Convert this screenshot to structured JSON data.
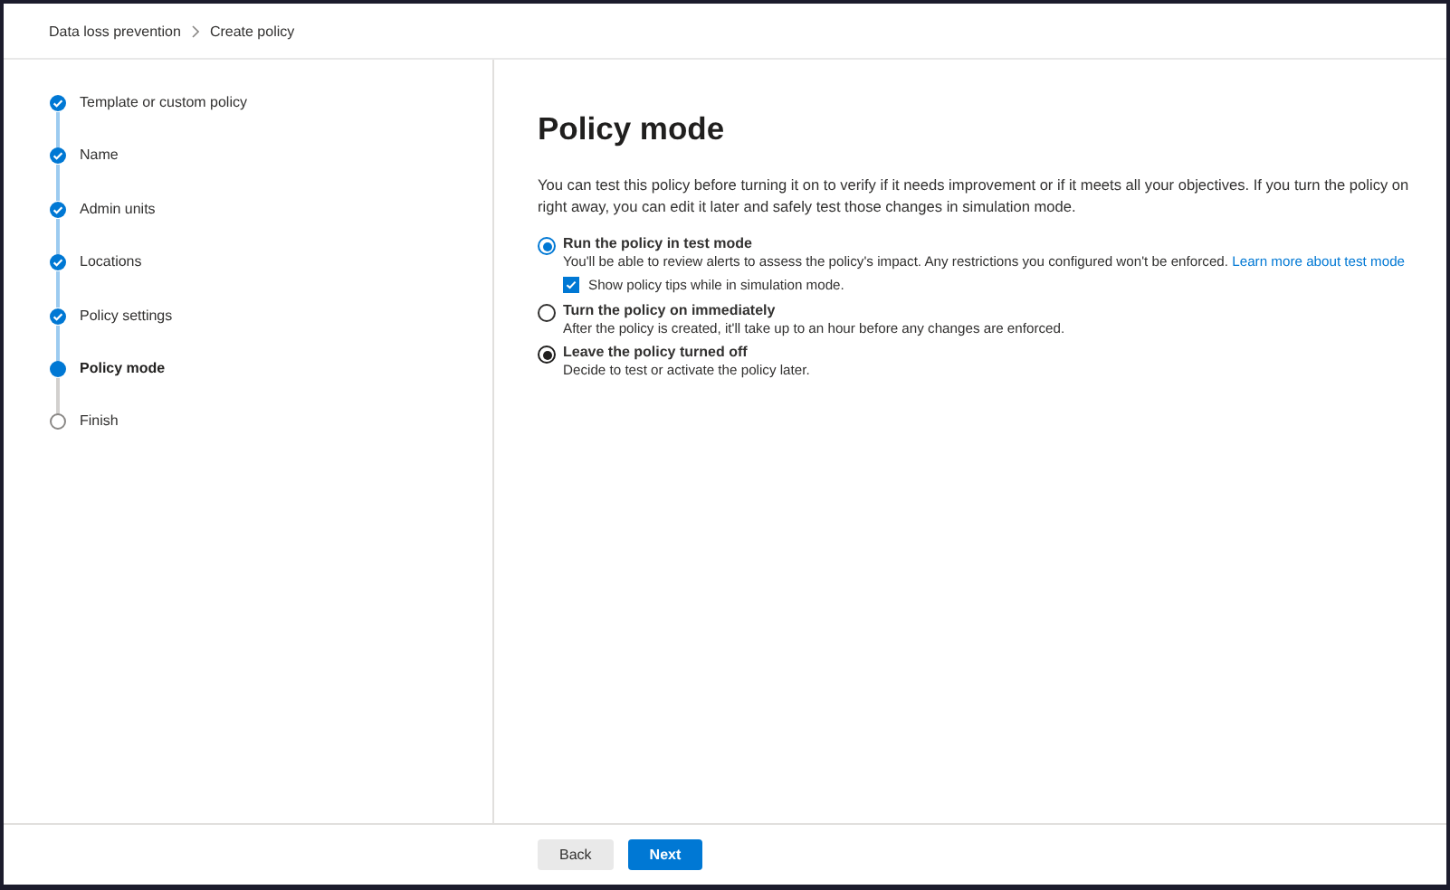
{
  "breadcrumb": [
    "Data loss prevention",
    "Create policy"
  ],
  "steps": [
    {
      "label": "Template or custom policy",
      "completed": true,
      "selected": false
    },
    {
      "label": "Name",
      "completed": true,
      "selected": false
    },
    {
      "label": "Admin units",
      "completed": true,
      "selected": false
    },
    {
      "label": "Locations",
      "completed": true,
      "selected": false
    },
    {
      "label": "Policy settings",
      "completed": true,
      "selected": false
    },
    {
      "label": "Policy mode",
      "completed": false,
      "selected": true
    },
    {
      "label": "Finish",
      "completed": false,
      "selected": false
    }
  ],
  "title": "Policy mode",
  "description": "You can test this policy before turning it on to verify if it needs improvement or if it meets all your objectives. If you turn the policy on right away, you can edit it later and safely test those changes in simulation mode.",
  "options": [
    {
      "label": "Run the policy in test mode",
      "detail": "You'll be able to review alerts to assess the policy's impact. Any restrictions you configured won't be enforced.",
      "link": "Learn more about test mode",
      "selected": true,
      "color": "#0078d4",
      "checkbox": {
        "label": "Show policy tips while in simulation mode.",
        "checked": true
      }
    },
    {
      "label": "Turn the policy on immediately",
      "detail": "After the policy is created, it'll take up to an hour before any changes are enforced.",
      "selected": false,
      "color": "#323130"
    },
    {
      "label": "Leave the policy turned off",
      "detail": "Decide to test or activate the policy later.",
      "selected": true,
      "color": "#201f1e"
    }
  ],
  "buttons": [
    {
      "label": "Back",
      "kind": "secondary"
    },
    {
      "label": "Next",
      "kind": "primary"
    }
  ]
}
